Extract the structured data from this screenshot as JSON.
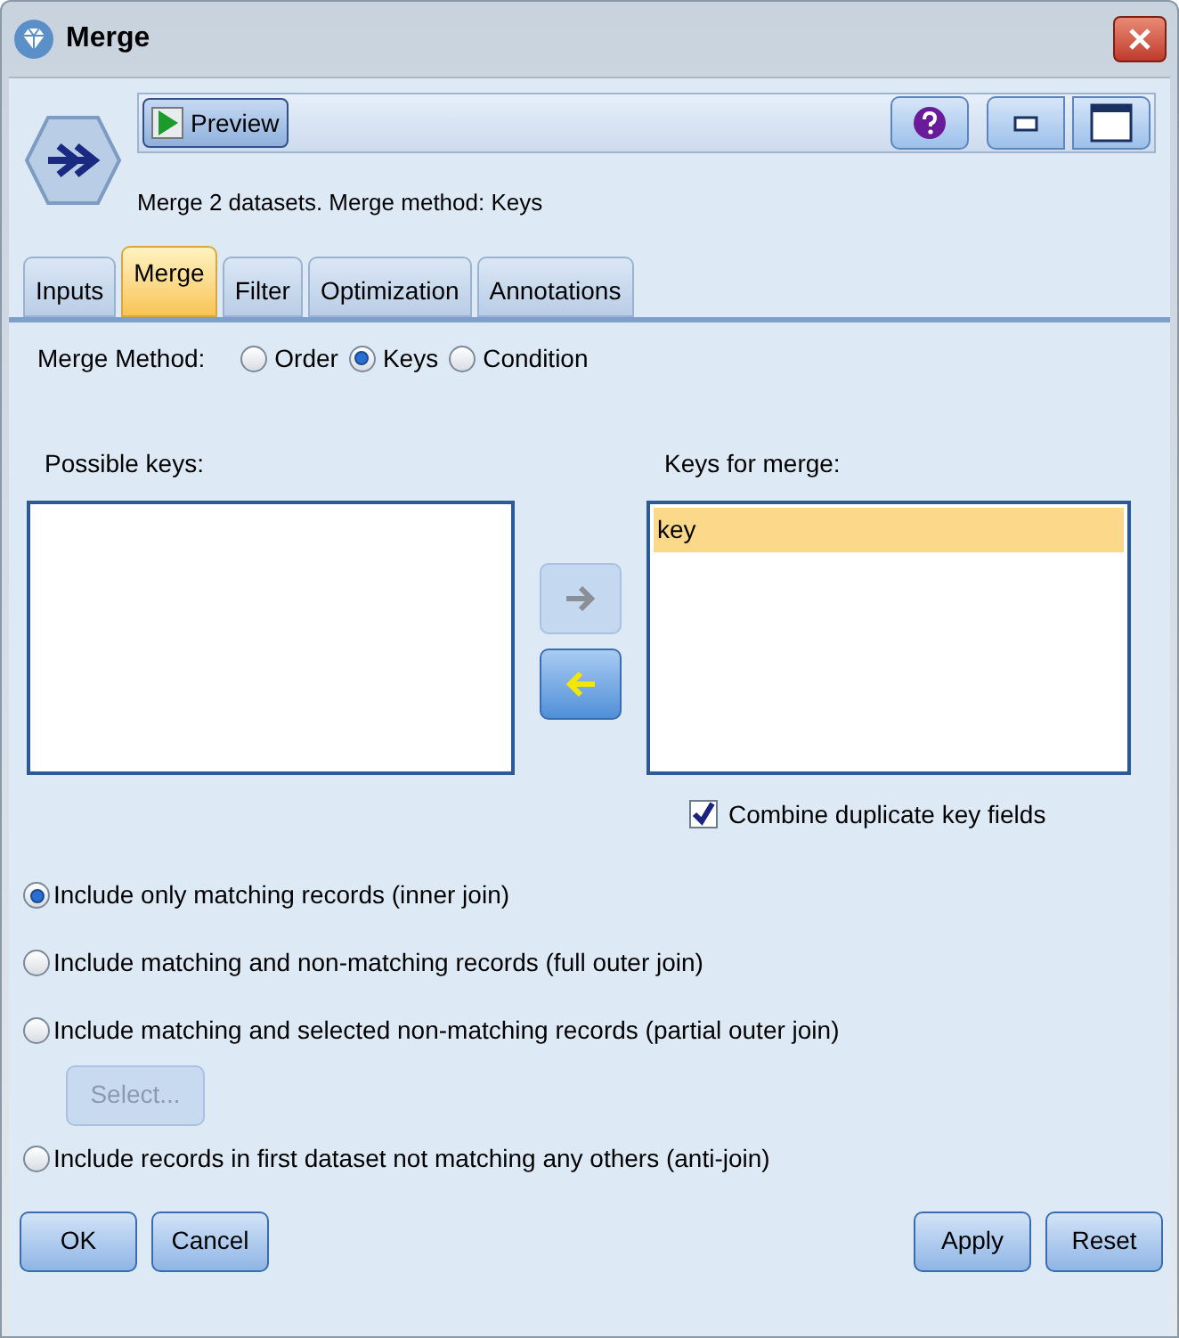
{
  "window": {
    "title": "Merge"
  },
  "toolbar": {
    "preview_button": "Preview"
  },
  "description": "Merge 2 datasets. Merge method: Keys",
  "tabs": [
    {
      "label": "Inputs",
      "selected": false
    },
    {
      "label": "Merge",
      "selected": true
    },
    {
      "label": "Filter",
      "selected": false
    },
    {
      "label": "Optimization",
      "selected": false
    },
    {
      "label": "Annotations",
      "selected": false
    }
  ],
  "merge_method": {
    "label": "Merge Method:",
    "options": [
      {
        "label": "Order",
        "selected": false
      },
      {
        "label": "Keys",
        "selected": true
      },
      {
        "label": "Condition",
        "selected": false
      }
    ]
  },
  "possible_keys": {
    "label": "Possible keys:"
  },
  "add_button": {
    "disabled": true
  },
  "remove_button": {
    "disabled": false
  },
  "keys_for_merge": {
    "label": "Keys for merge:",
    "items": [
      {
        "label": "key",
        "selected": true
      }
    ]
  },
  "combine_duplicates": {
    "label": "Combine duplicate key fields",
    "checked": true
  },
  "join_options": [
    {
      "label": "Include only matching records (inner join)",
      "selected": true
    },
    {
      "label": "Include matching and non-matching records (full outer join)",
      "selected": false
    },
    {
      "label": "Include matching and selected non-matching records (partial outer join)",
      "selected": false,
      "select_button": {
        "label": "Select...",
        "disabled": true
      }
    },
    {
      "label": "Include records in first dataset not matching any others (anti-join)",
      "selected": false
    }
  ],
  "buttons_left": [
    "OK",
    "Cancel"
  ],
  "buttons_right": [
    "Apply",
    "Reset"
  ]
}
